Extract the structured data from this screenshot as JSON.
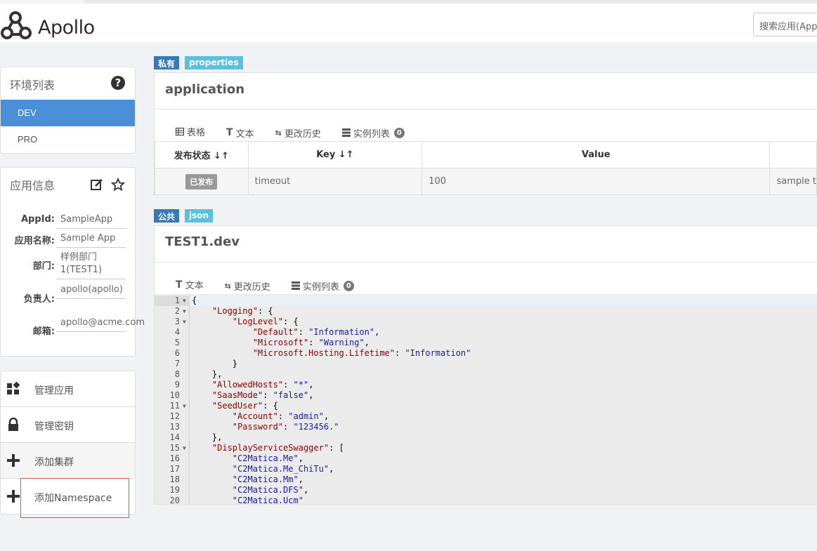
{
  "app": {
    "logo_text": "Apollo"
  },
  "search": {
    "placeholder": "搜索应用(AppId、应用名)"
  },
  "env_panel": {
    "title": "环境列表",
    "items": [
      {
        "label": "DEV",
        "active": true
      },
      {
        "label": "PRO",
        "active": false
      }
    ]
  },
  "app_info": {
    "title": "应用信息",
    "rows": [
      {
        "label": "AppId:",
        "value": "SampleApp"
      },
      {
        "label": "应用名称:",
        "value": "Sample App"
      },
      {
        "label": "部门:",
        "value": "样例部门1(TEST1)"
      },
      {
        "label": "负责人:",
        "value": "apollo(apollo)"
      },
      {
        "label": "邮箱:",
        "value": "apollo@acme.com"
      }
    ]
  },
  "menu": {
    "items": [
      {
        "label": "管理应用",
        "icon": "dashboard-icon"
      },
      {
        "label": "管理密钥",
        "icon": "lock-icon"
      },
      {
        "label": "添加集群",
        "icon": "plus-icon"
      },
      {
        "label": "添加Namespace",
        "icon": "plus-icon"
      }
    ]
  },
  "ns1": {
    "tag_scope": "私有",
    "tag_format": "properties",
    "title": "application",
    "tabs": {
      "table": "表格",
      "text": "文本",
      "history": "更改历史",
      "instances": "实例列表",
      "instances_count": "0"
    },
    "columns": {
      "status": "发布状态",
      "key": "Key",
      "value": "Value"
    },
    "rows": [
      {
        "status": "已发布",
        "key": "timeout",
        "value": "100",
        "comment": "sample t"
      }
    ]
  },
  "ns2": {
    "tag_scope": "公共",
    "tag_format": "json",
    "title": "TEST1.dev",
    "tabs": {
      "text": "文本",
      "history": "更改历史",
      "instances": "实例列表",
      "instances_count": "0"
    },
    "code_lines": [
      "{",
      "    \"Logging\": {",
      "        \"LogLevel\": {",
      "            \"Default\": \"Information\",",
      "            \"Microsoft\": \"Warning\",",
      "            \"Microsoft.Hosting.Lifetime\": \"Information\"",
      "        }",
      "    },",
      "    \"AllowedHosts\": \"*\",",
      "    \"SaasMode\": \"false\",",
      "    \"SeedUser\": {",
      "        \"Account\": \"admin\",",
      "        \"Password\": \"123456.\"",
      "    },",
      "    \"DisplayServiceSwagger\": [",
      "        \"C2Matica.Me\",",
      "        \"C2Matica.Me_ChiTu\",",
      "        \"C2Matica.Mm\",",
      "        \"C2Matica.DFS\",",
      "        \"C2Matica.Ucm\""
    ],
    "foldable_lines": [
      1,
      2,
      3,
      11,
      15
    ]
  },
  "colors": {
    "accent": "#337ab7",
    "env_active": "#4a90d9",
    "tag_format": "#5bc0de",
    "highlight": "#d9534f"
  }
}
